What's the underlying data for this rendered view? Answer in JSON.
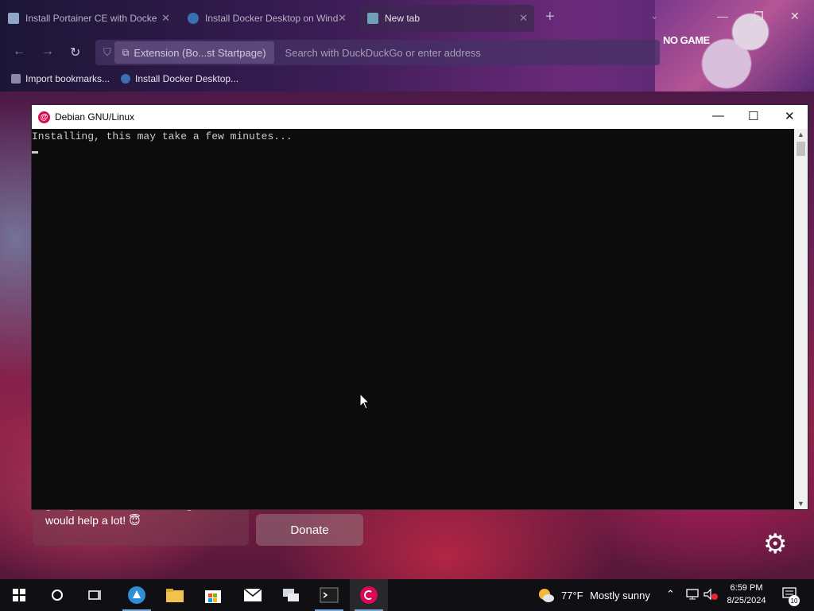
{
  "browser": {
    "tabs": [
      {
        "label": "Install Portainer CE with Docke",
        "active": false
      },
      {
        "label": "Install Docker Desktop on Wind",
        "active": false
      },
      {
        "label": "New tab",
        "active": true
      }
    ],
    "extension_chip": "Extension (Bo...st Startpage)",
    "address_placeholder": "Search with DuckDuckGo or enter address",
    "bookmarks": [
      "Import bookmarks...",
      "Install Docker Desktop..."
    ],
    "theme_text": "NO GAME"
  },
  "page": {
    "review_text_line1": "giving us a review or donating, that",
    "review_text_line2": "would help a lot! 😇",
    "donate_label": "Donate"
  },
  "terminal": {
    "title": "Debian GNU/Linux",
    "output": "Installing, this may take a few minutes..."
  },
  "taskbar": {
    "weather_temp": "77°F",
    "weather_text": "Mostly sunny",
    "time": "6:59 PM",
    "date": "8/25/2024",
    "notification_count": "10"
  },
  "colors": {
    "debian_red": "#d70a53",
    "terminal_bg": "#0c0c0c",
    "taskbar_bg": "#101014"
  }
}
